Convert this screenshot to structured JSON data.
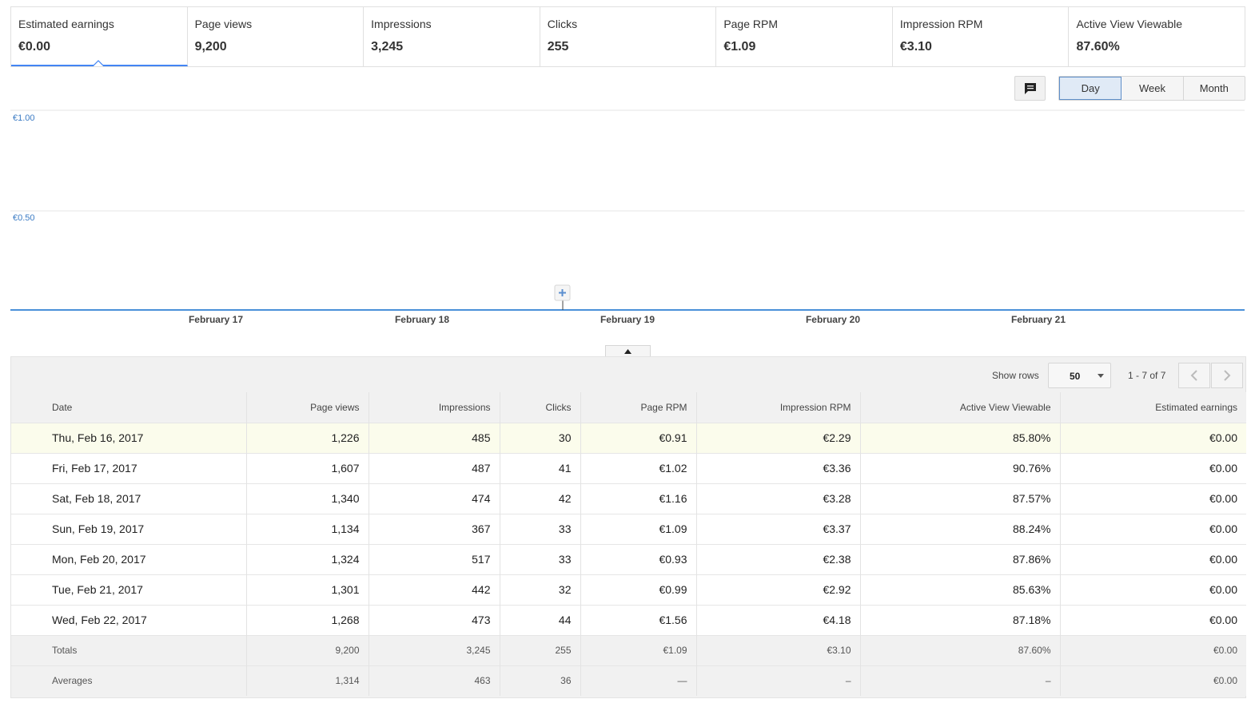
{
  "metrics": [
    {
      "label": "Estimated earnings",
      "value": "€0.00",
      "active": true
    },
    {
      "label": "Page views",
      "value": "9,200"
    },
    {
      "label": "Impressions",
      "value": "3,245"
    },
    {
      "label": "Clicks",
      "value": "255"
    },
    {
      "label": "Page RPM",
      "value": "€1.09"
    },
    {
      "label": "Impression RPM",
      "value": "€3.10"
    },
    {
      "label": "Active View Viewable",
      "value": "87.60%"
    }
  ],
  "controls": {
    "comment_icon": "comment-icon",
    "period_options": [
      "Day",
      "Week",
      "Month"
    ],
    "period_selected": "Day"
  },
  "chart_data": {
    "type": "line",
    "series": [
      {
        "values": [
          0,
          0,
          0,
          0,
          0,
          0,
          0
        ]
      }
    ],
    "x": [
      "2017-02-16",
      "2017-02-17",
      "2017-02-18",
      "2017-02-19",
      "2017-02-20",
      "2017-02-21",
      "2017-02-22"
    ],
    "x_tick_labels": [
      "February 17",
      "February 18",
      "February 19",
      "February 20",
      "February 21"
    ],
    "y_tick_labels": [
      "€1.00",
      "€0.50"
    ],
    "ylim": [
      0,
      1.0
    ],
    "grid": true,
    "line_color": "#4a90d9"
  },
  "table": {
    "show_rows_label": "Show rows",
    "rows_per_page": "50",
    "pager_text": "1 - 7 of 7",
    "columns": [
      "Date",
      "Page views",
      "Impressions",
      "Clicks",
      "Page RPM",
      "Impression RPM",
      "Active View Viewable",
      "Estimated earnings"
    ],
    "rows": [
      [
        "Thu, Feb 16, 2017",
        "1,226",
        "485",
        "30",
        "€0.91",
        "€2.29",
        "85.80%",
        "€0.00"
      ],
      [
        "Fri, Feb 17, 2017",
        "1,607",
        "487",
        "41",
        "€1.02",
        "€3.36",
        "90.76%",
        "€0.00"
      ],
      [
        "Sat, Feb 18, 2017",
        "1,340",
        "474",
        "42",
        "€1.16",
        "€3.28",
        "87.57%",
        "€0.00"
      ],
      [
        "Sun, Feb 19, 2017",
        "1,134",
        "367",
        "33",
        "€1.09",
        "€3.37",
        "88.24%",
        "€0.00"
      ],
      [
        "Mon, Feb 20, 2017",
        "1,324",
        "517",
        "33",
        "€0.93",
        "€2.38",
        "87.86%",
        "€0.00"
      ],
      [
        "Tue, Feb 21, 2017",
        "1,301",
        "442",
        "32",
        "€0.99",
        "€2.92",
        "85.63%",
        "€0.00"
      ],
      [
        "Wed, Feb 22, 2017",
        "1,268",
        "473",
        "44",
        "€1.56",
        "€4.18",
        "87.18%",
        "€0.00"
      ]
    ],
    "totals": [
      "Totals",
      "9,200",
      "3,245",
      "255",
      "€1.09",
      "€3.10",
      "87.60%",
      "€0.00"
    ],
    "averages": [
      "Averages",
      "1,314",
      "463",
      "36",
      "—",
      "–",
      "–",
      "€0.00"
    ]
  }
}
